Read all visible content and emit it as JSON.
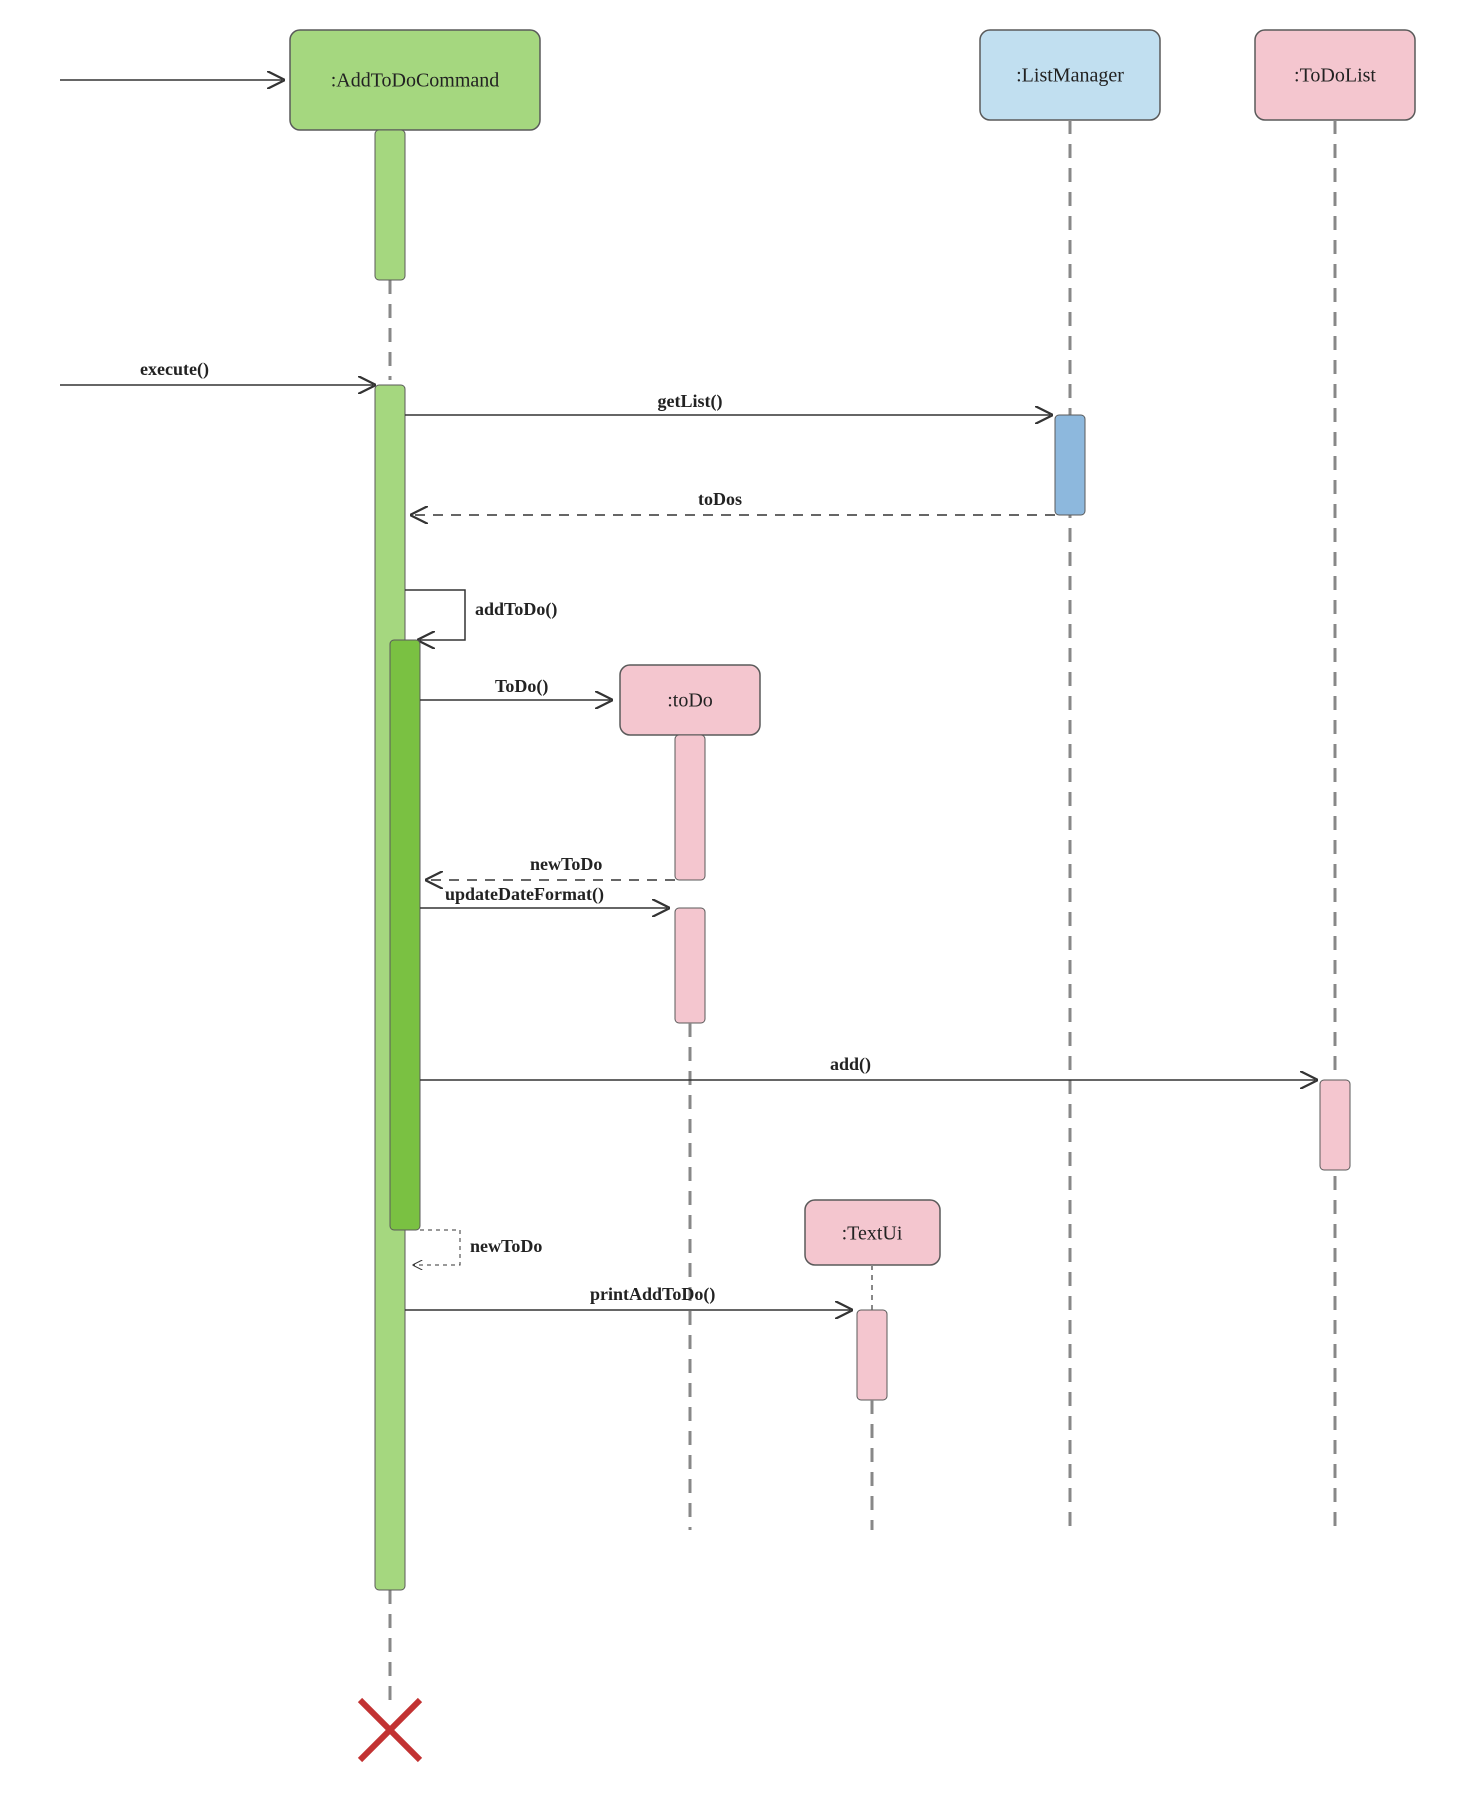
{
  "diagram": {
    "type": "uml-sequence",
    "participants": {
      "addToDoCommand": {
        "label": ":AddToDoCommand",
        "color": "green"
      },
      "listManager": {
        "label": ":ListManager",
        "color": "blue"
      },
      "toDoList": {
        "label": ":ToDoList",
        "color": "pink"
      },
      "toDo": {
        "label": ":toDo",
        "color": "pink"
      },
      "textUi": {
        "label": ":TextUi",
        "color": "pink"
      }
    },
    "messages": {
      "execute": "execute()",
      "getList": "getList()",
      "toDos": "toDos",
      "addToDo": "addToDo()",
      "ToDo": "ToDo()",
      "newToDo": "newToDo",
      "updateDateFormat": "updateDateFormat()",
      "add": "add()",
      "newToDo2": "newToDo",
      "printAddToDo": "printAddToDo()"
    }
  }
}
